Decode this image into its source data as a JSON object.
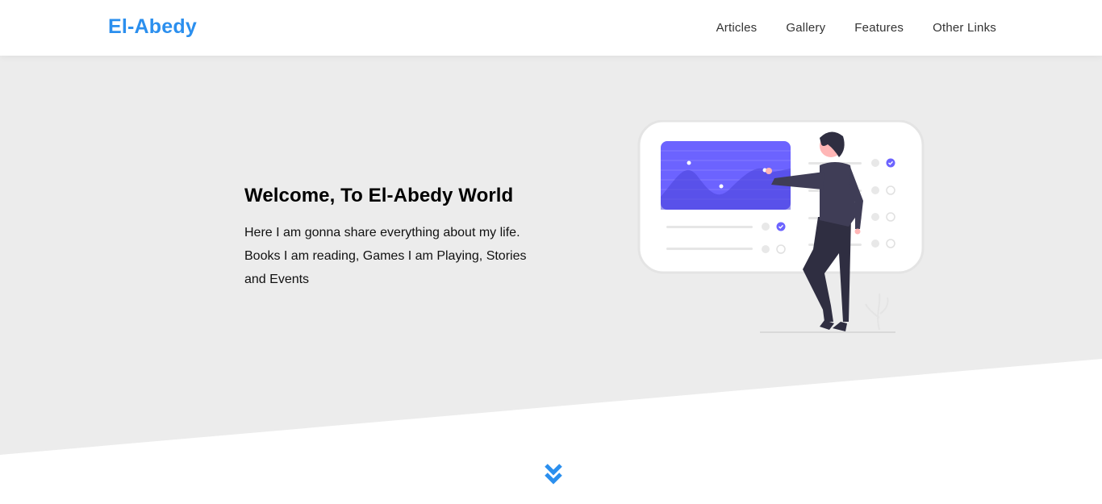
{
  "colors": {
    "accent": "#2b8fee",
    "illustration_primary": "#6c63ff",
    "landing_bg": "#ececec"
  },
  "header": {
    "logo": "El-Abedy",
    "nav": [
      {
        "label": "Articles"
      },
      {
        "label": "Gallery"
      },
      {
        "label": "Features"
      },
      {
        "label": "Other Links"
      }
    ]
  },
  "landing": {
    "title": "Welcome, To El-Abedy World",
    "description": "Here I am gonna share everything about my life. Books I am reading, Games I am Playing, Stories and Events"
  },
  "icons": {
    "hero": "person-presenting-dashboard-illustration",
    "go_down": "double-chevron-down-icon"
  }
}
